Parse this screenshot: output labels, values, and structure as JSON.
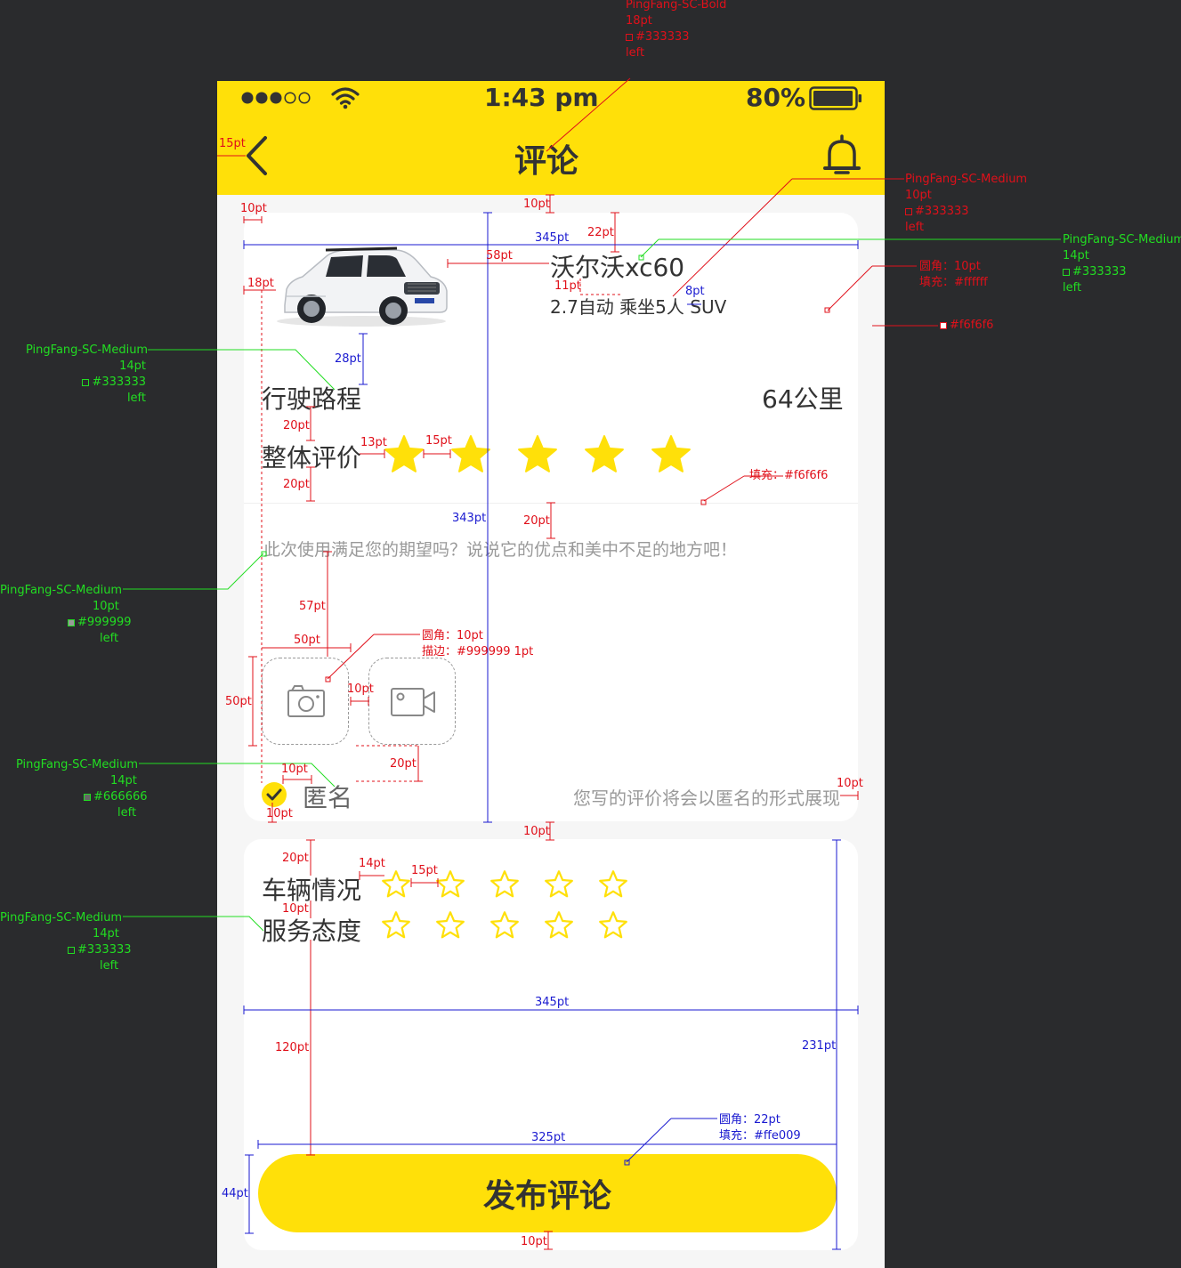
{
  "status_bar": {
    "time": "1:43 pm",
    "battery": "80%"
  },
  "nav": {
    "title": "评论"
  },
  "car": {
    "name": "沃尔沃xc60",
    "spec": "2.7自动  乘坐5人  SUV",
    "plate_text": ""
  },
  "mileage": {
    "label": "行驶路程",
    "value": "64公里"
  },
  "overall": {
    "label": "整体评价",
    "rating": 5,
    "max": 5
  },
  "review": {
    "placeholder": "此次使用满足您的期望吗？说说它的优点和美中不足的地方吧！"
  },
  "anonymous": {
    "label": "匿名",
    "hint": "您写的评价将会以匿名的形式展现",
    "checked": true
  },
  "vehicle_condition": {
    "label": "车辆情况",
    "rating": 0,
    "max": 5
  },
  "service_attitude": {
    "label": "服务态度",
    "rating": 0,
    "max": 5
  },
  "publish": {
    "label": "发布评论"
  },
  "colors": {
    "accent": "#ffe009",
    "text": "#333333",
    "muted": "#999999",
    "secondary": "#666666",
    "bg": "#f6f6f6",
    "card": "#ffffff"
  },
  "annotations": {
    "title_font": [
      "PingFang-SC-Bold",
      "18pt",
      "#333333",
      "left"
    ],
    "spec_font": [
      "PingFang-SC-Medium",
      "10pt",
      "#333333",
      "left"
    ],
    "name_font": [
      "PingFang-SC-Medium",
      "14pt",
      "#333333",
      "left"
    ],
    "card_radius": [
      "圆角：10pt",
      "填充：#ffffff"
    ],
    "page_bg": "#f6f6f6",
    "label_font": [
      "PingFang-SC-Medium",
      "14pt",
      "#333333",
      "left"
    ],
    "divider_fill": "填充：#f6f6f6",
    "placeholder_font": [
      "PingFang-SC-Medium",
      "10pt",
      "#999999",
      "left"
    ],
    "upload_style": [
      "圆角：10pt",
      "描边：#999999  1pt"
    ],
    "anon_font": [
      "PingFang-SC-Medium",
      "14pt",
      "#666666",
      "left"
    ],
    "rating_font": [
      "PingFang-SC-Medium",
      "14pt",
      "#333333",
      "left"
    ],
    "button_style": [
      "圆角：22pt",
      "填充：#ffe009"
    ],
    "dims": {
      "d15": "15pt",
      "d10a": "10pt",
      "d22": "22pt",
      "d345a": "345pt",
      "d10b": "10pt",
      "d58": "58pt",
      "d18": "18pt",
      "d11": "11pt",
      "d8": "8pt",
      "d28": "28pt",
      "d20a": "20pt",
      "d13": "13pt",
      "d15b": "15pt",
      "d20b": "20pt",
      "d343": "343pt",
      "d20c": "20pt",
      "d57": "57pt",
      "d50a": "50pt",
      "d50b": "50pt",
      "d10c": "10pt",
      "d20d": "20pt",
      "d10d": "10pt",
      "d10e": "10pt",
      "d10f": "10pt",
      "d10g": "10pt",
      "d20e": "20pt",
      "d14": "14pt",
      "d15c": "15pt",
      "d10h": "10pt",
      "d345b": "345pt",
      "d120": "120pt",
      "d231": "231pt",
      "d325": "325pt",
      "d44": "44pt",
      "d10i": "10pt"
    }
  }
}
